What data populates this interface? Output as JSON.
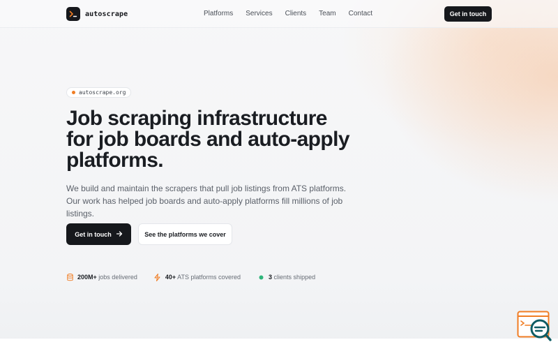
{
  "brand": {
    "name": "autoscrape"
  },
  "nav": {
    "items": [
      {
        "label": "Platforms"
      },
      {
        "label": "Services"
      },
      {
        "label": "Clients"
      },
      {
        "label": "Team"
      },
      {
        "label": "Contact"
      }
    ],
    "cta_label": "Get in touch"
  },
  "hero": {
    "badge": "autoscrape.org",
    "title_lines": [
      "Job scraping infrastructure",
      "for job boards and auto-apply",
      "platforms."
    ],
    "subtitle": "We build and maintain the scrapers that pull job listings from ATS platforms. Our work has helped job boards and auto-apply platforms fill millions of job listings.",
    "primary_cta": "Get in touch",
    "secondary_cta": "See the platforms we cover"
  },
  "stats": [
    {
      "value": "200M+",
      "label": "jobs delivered",
      "icon": "database-icon"
    },
    {
      "value": "40+",
      "label": "ATS platforms covered",
      "icon": "lightning-icon"
    },
    {
      "value": "3",
      "label": "clients shipped",
      "icon": "status-dot-icon"
    }
  ],
  "colors": {
    "accent": "#f07d24",
    "dark": "#16181c",
    "success": "#2fb57a",
    "widget_teal": "#0f5c63"
  }
}
